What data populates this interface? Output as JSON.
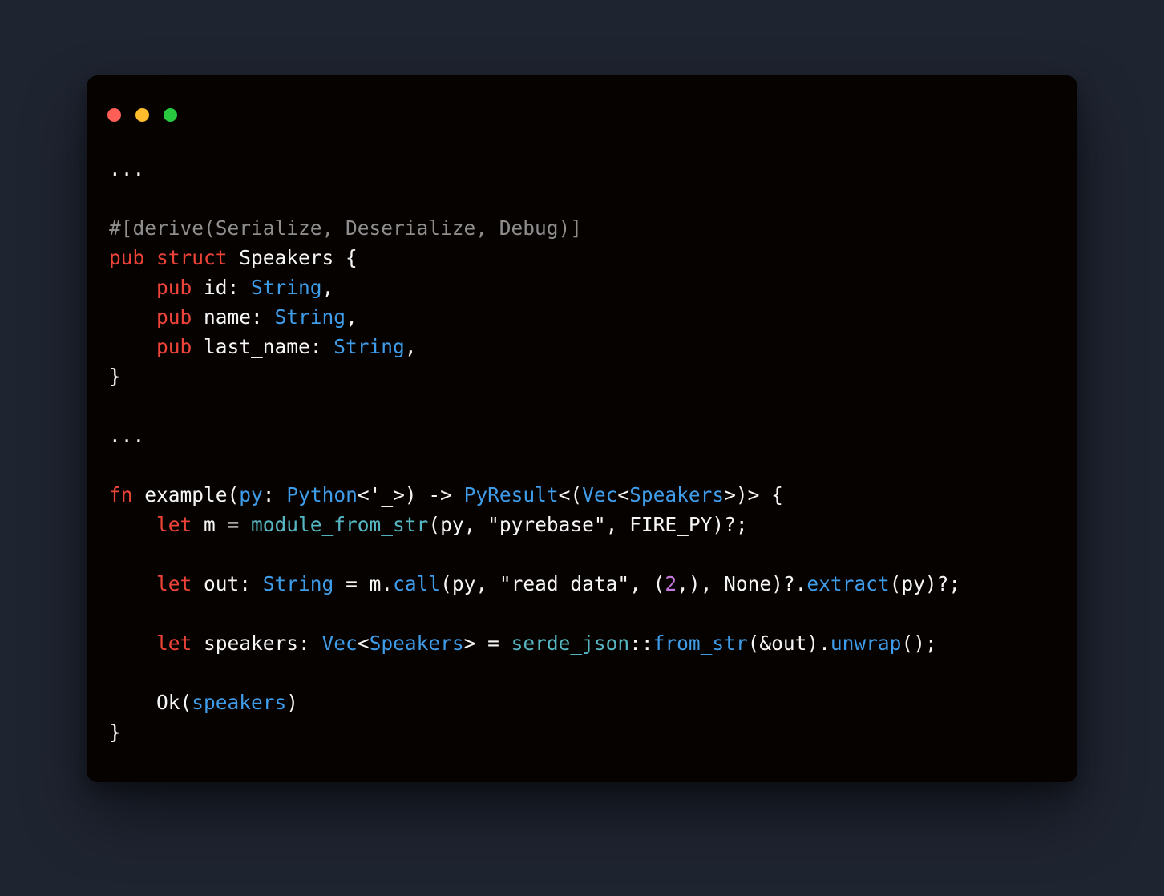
{
  "window": {
    "traffic": {
      "close": "close-icon",
      "min": "minimize-icon",
      "zoom": "zoom-icon"
    }
  },
  "colors": {
    "background": "#1f2431",
    "editor_bg": "#060200",
    "keyword": "#ee4338",
    "type": "#3f9ce8",
    "teal": "#56b6c2",
    "comment": "#8e8e8e",
    "number": "#c678dd",
    "plain": "#f6f6f6"
  },
  "code": {
    "tokens": [
      [
        {
          "c": "plain",
          "t": "..."
        }
      ],
      [],
      [
        {
          "c": "comment",
          "t": "#[derive(Serialize, Deserialize, Debug)]"
        }
      ],
      [
        {
          "c": "keyword",
          "t": "pub"
        },
        {
          "c": "plain",
          "t": " "
        },
        {
          "c": "keyword",
          "t": "struct"
        },
        {
          "c": "plain",
          "t": " Speakers {"
        }
      ],
      [
        {
          "c": "plain",
          "t": "    "
        },
        {
          "c": "keyword",
          "t": "pub"
        },
        {
          "c": "plain",
          "t": " id: "
        },
        {
          "c": "type",
          "t": "String"
        },
        {
          "c": "plain",
          "t": ","
        }
      ],
      [
        {
          "c": "plain",
          "t": "    "
        },
        {
          "c": "keyword",
          "t": "pub"
        },
        {
          "c": "plain",
          "t": " name: "
        },
        {
          "c": "type",
          "t": "String"
        },
        {
          "c": "plain",
          "t": ","
        }
      ],
      [
        {
          "c": "plain",
          "t": "    "
        },
        {
          "c": "keyword",
          "t": "pub"
        },
        {
          "c": "plain",
          "t": " last_name: "
        },
        {
          "c": "type",
          "t": "String"
        },
        {
          "c": "plain",
          "t": ","
        }
      ],
      [
        {
          "c": "plain",
          "t": "}"
        }
      ],
      [],
      [
        {
          "c": "plain",
          "t": "..."
        }
      ],
      [],
      [
        {
          "c": "keyword",
          "t": "fn"
        },
        {
          "c": "plain",
          "t": " example("
        },
        {
          "c": "param",
          "t": "py"
        },
        {
          "c": "plain",
          "t": ": "
        },
        {
          "c": "type",
          "t": "Python"
        },
        {
          "c": "plain",
          "t": "<'_>) -> "
        },
        {
          "c": "type",
          "t": "PyResult"
        },
        {
          "c": "plain",
          "t": "<("
        },
        {
          "c": "type",
          "t": "Vec"
        },
        {
          "c": "plain",
          "t": "<"
        },
        {
          "c": "type",
          "t": "Speakers"
        },
        {
          "c": "plain",
          "t": ">)> {"
        }
      ],
      [
        {
          "c": "plain",
          "t": "    "
        },
        {
          "c": "keyword",
          "t": "let"
        },
        {
          "c": "plain",
          "t": " m = "
        },
        {
          "c": "teal",
          "t": "module_from_str"
        },
        {
          "c": "plain",
          "t": "(py, \"pyrebase\", FIRE_PY)?;"
        }
      ],
      [],
      [
        {
          "c": "plain",
          "t": "    "
        },
        {
          "c": "keyword",
          "t": "let"
        },
        {
          "c": "plain",
          "t": " out: "
        },
        {
          "c": "type",
          "t": "String"
        },
        {
          "c": "plain",
          "t": " = m."
        },
        {
          "c": "type",
          "t": "call"
        },
        {
          "c": "plain",
          "t": "(py, \"read_data\", ("
        },
        {
          "c": "number",
          "t": "2"
        },
        {
          "c": "plain",
          "t": ",), None)?."
        },
        {
          "c": "type",
          "t": "extract"
        },
        {
          "c": "plain",
          "t": "(py)?;"
        }
      ],
      [],
      [
        {
          "c": "plain",
          "t": "    "
        },
        {
          "c": "keyword",
          "t": "let"
        },
        {
          "c": "plain",
          "t": " speakers: "
        },
        {
          "c": "type",
          "t": "Vec"
        },
        {
          "c": "plain",
          "t": "<"
        },
        {
          "c": "type",
          "t": "Speakers"
        },
        {
          "c": "plain",
          "t": "> = "
        },
        {
          "c": "teal",
          "t": "serde_json"
        },
        {
          "c": "plain",
          "t": "::"
        },
        {
          "c": "type",
          "t": "from_str"
        },
        {
          "c": "plain",
          "t": "(&out)."
        },
        {
          "c": "type",
          "t": "unwrap"
        },
        {
          "c": "plain",
          "t": "();"
        }
      ],
      [],
      [
        {
          "c": "plain",
          "t": "    Ok("
        },
        {
          "c": "type",
          "t": "speakers"
        },
        {
          "c": "plain",
          "t": ")"
        }
      ],
      [
        {
          "c": "plain",
          "t": "}"
        }
      ]
    ]
  }
}
